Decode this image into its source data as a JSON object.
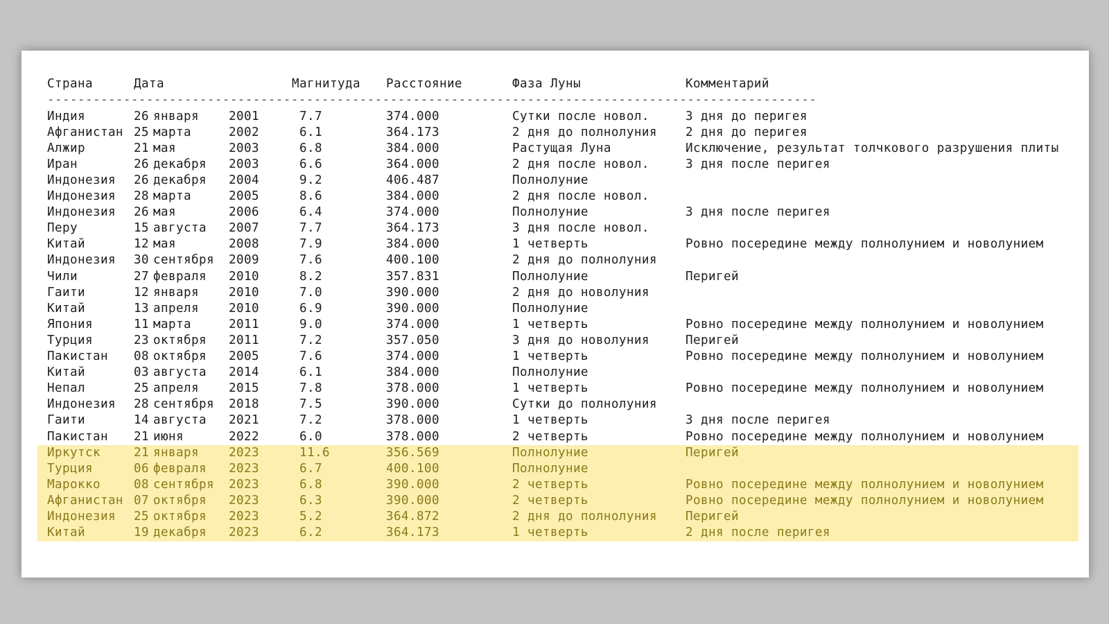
{
  "headers": {
    "country": "Страна",
    "date": "Дата",
    "magnitude": "Магнитуда",
    "distance": "Расстояние",
    "phase": "Фаза Луны",
    "comment": "Комментарий"
  },
  "divider": "----------------------------------------------------------------------------------------------------------------",
  "rows": [
    {
      "country": "Индия",
      "day": "26",
      "month": "января",
      "year": "2001",
      "mag": "7.7",
      "dist": "374.000",
      "phase": "Сутки после новол.",
      "comment": "3 дня до перигея",
      "highlight": false
    },
    {
      "country": "Афганистан",
      "day": "25",
      "month": "марта",
      "year": "2002",
      "mag": "6.1",
      "dist": "364.173",
      "phase": "2 дня до полнолуния",
      "comment": "2 дня до перигея",
      "highlight": false
    },
    {
      "country": "Алжир",
      "day": "21",
      "month": "мая",
      "year": "2003",
      "mag": "6.8",
      "dist": "384.000",
      "phase": "Растущая Луна",
      "comment": "Исключение, результат толчкового разрушения плиты",
      "highlight": false
    },
    {
      "country": "Иран",
      "day": "26",
      "month": "декабря",
      "year": "2003",
      "mag": "6.6",
      "dist": "364.000",
      "phase": "2 дня после новол.",
      "comment": "3 дня после перигея",
      "highlight": false
    },
    {
      "country": "Индонезия",
      "day": "26",
      "month": "декабря",
      "year": "2004",
      "mag": "9.2",
      "dist": "406.487",
      "phase": "Полнолуние",
      "comment": "",
      "highlight": false
    },
    {
      "country": "Индонезия",
      "day": "28",
      "month": "марта",
      "year": "2005",
      "mag": "8.6",
      "dist": "384.000",
      "phase": "2 дня после новол.",
      "comment": "",
      "highlight": false
    },
    {
      "country": "Индонезия",
      "day": "26",
      "month": "мая",
      "year": "2006",
      "mag": "6.4",
      "dist": "374.000",
      "phase": "Полнолуние",
      "comment": "3 дня после перигея",
      "highlight": false
    },
    {
      "country": "Перу",
      "day": "15",
      "month": "августа",
      "year": "2007",
      "mag": "7.7",
      "dist": "364.173",
      "phase": "3 дня после новол.",
      "comment": "",
      "highlight": false
    },
    {
      "country": "Китай",
      "day": "12",
      "month": "мая",
      "year": "2008",
      "mag": "7.9",
      "dist": "384.000",
      "phase": "1 четверть",
      "comment": "Ровно посередине между полнолунием и новолунием",
      "highlight": false
    },
    {
      "country": "Индонезия",
      "day": "30",
      "month": "сентября",
      "year": "2009",
      "mag": "7.6",
      "dist": "400.100",
      "phase": "2 дня до полнолуния",
      "comment": "",
      "highlight": false
    },
    {
      "country": "Чили",
      "day": "27",
      "month": "февраля",
      "year": "2010",
      "mag": "8.2",
      "dist": "357.831",
      "phase": "Полнолуние",
      "comment": "Перигей",
      "highlight": false
    },
    {
      "country": "Гаити",
      "day": "12",
      "month": "января",
      "year": "2010",
      "mag": "7.0",
      "dist": "390.000",
      "phase": "2 дня до новолуния",
      "comment": "",
      "highlight": false
    },
    {
      "country": "Китай",
      "day": "13",
      "month": "апреля",
      "year": "2010",
      "mag": "6.9",
      "dist": "390.000",
      "phase": "Полнолуние",
      "comment": "",
      "highlight": false
    },
    {
      "country": "Япония",
      "day": "11",
      "month": "марта",
      "year": "2011",
      "mag": "9.0",
      "dist": "374.000",
      "phase": "1 четверть",
      "comment": "Ровно посередине между полнолунием и новолунием",
      "highlight": false
    },
    {
      "country": "Турция",
      "day": "23",
      "month": "октября",
      "year": "2011",
      "mag": "7.2",
      "dist": "357.050",
      "phase": "3 дня до новолуния",
      "comment": "Перигей",
      "highlight": false
    },
    {
      "country": "Пакистан",
      "day": "08",
      "month": "октября",
      "year": "2005",
      "mag": "7.6",
      "dist": "374.000",
      "phase": "1 четверть",
      "comment": "Ровно посередине между полнолунием и новолунием",
      "highlight": false
    },
    {
      "country": "Китай",
      "day": "03",
      "month": "августа",
      "year": "2014",
      "mag": "6.1",
      "dist": "384.000",
      "phase": "Полнолуние",
      "comment": "",
      "highlight": false
    },
    {
      "country": "Непал",
      "day": "25",
      "month": "апреля",
      "year": "2015",
      "mag": "7.8",
      "dist": "378.000",
      "phase": "1 четверть",
      "comment": "Ровно посередине между полнолунием и новолунием",
      "highlight": false
    },
    {
      "country": "Индонезия",
      "day": "28",
      "month": "сентября",
      "year": "2018",
      "mag": "7.5",
      "dist": "390.000",
      "phase": "Сутки до полнолуния",
      "comment": "",
      "highlight": false
    },
    {
      "country": "Гаити",
      "day": "14",
      "month": "августа",
      "year": "2021",
      "mag": "7.2",
      "dist": "378.000",
      "phase": "1 четверть",
      "comment": "3 дня после перигея",
      "highlight": false
    },
    {
      "country": "Пакистан",
      "day": "21",
      "month": "июня",
      "year": "2022",
      "mag": "6.0",
      "dist": "378.000",
      "phase": "2 четверть",
      "comment": "Ровно посередине между полнолунием и новолунием",
      "highlight": false
    },
    {
      "country": "Иркутск",
      "day": "21",
      "month": "января",
      "year": "2023",
      "mag": "11.6",
      "dist": "356.569",
      "phase": "Полнолуние",
      "comment": "Перигей",
      "highlight": true
    },
    {
      "country": "Турция",
      "day": "06",
      "month": "февраля",
      "year": "2023",
      "mag": "6.7",
      "dist": "400.100",
      "phase": "Полнолуние",
      "comment": "",
      "highlight": true
    },
    {
      "country": "Марокко",
      "day": "08",
      "month": "сентября",
      "year": "2023",
      "mag": "6.8",
      "dist": "390.000",
      "phase": "2 четверть",
      "comment": "Ровно посередине между полнолунием и новолунием",
      "highlight": true
    },
    {
      "country": "Афганистан",
      "day": "07",
      "month": "октября",
      "year": "2023",
      "mag": "6.3",
      "dist": "390.000",
      "phase": "2 четверть",
      "comment": "Ровно посередине между полнолунием и новолунием",
      "highlight": true
    },
    {
      "country": "Индонезия",
      "day": "25",
      "month": "октября",
      "year": "2023",
      "mag": "5.2",
      "dist": "364.872",
      "phase": "2 дня до полнолуния",
      "comment": "Перигей",
      "highlight": true
    },
    {
      "country": "Китай",
      "day": "19",
      "month": "декабря",
      "year": "2023",
      "mag": "6.2",
      "dist": "364.173",
      "phase": "1 четверть",
      "comment": "2 дня после перигея",
      "highlight": true
    }
  ]
}
